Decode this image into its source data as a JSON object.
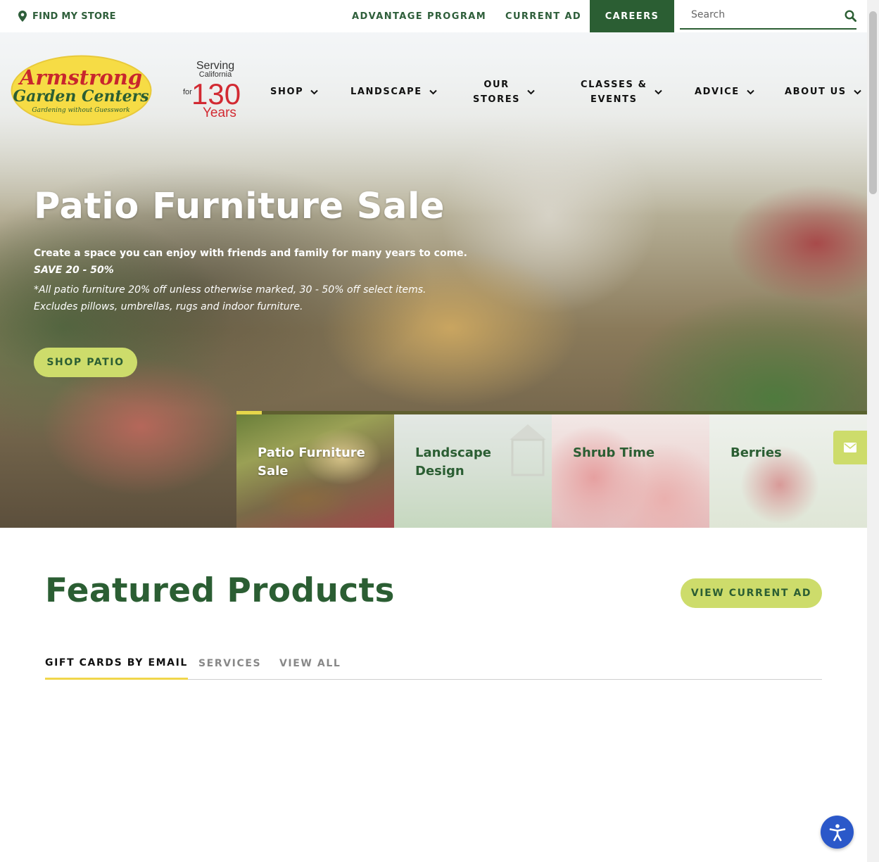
{
  "topbar": {
    "find_store": "FIND MY STORE",
    "links": [
      "ADVANTAGE PROGRAM",
      "CURRENT AD"
    ],
    "careers": "CAREERS",
    "search_placeholder": "Search"
  },
  "logo": {
    "line1": "Armstrong",
    "line2": "Garden Centers",
    "tagline": "Gardening without Guesswork"
  },
  "anniversary": {
    "serving": "Serving",
    "california": "California",
    "for": "for",
    "number": "130",
    "years": "Years"
  },
  "nav": {
    "shop": "SHOP",
    "landscape": "LANDSCAPE",
    "our_stores_1": "OUR",
    "our_stores_2": "STORES",
    "classes_1": "CLASSES &",
    "classes_2": "EVENTS",
    "advice": "ADVICE",
    "about": "ABOUT US"
  },
  "hero": {
    "title": "Patio Furniture Sale",
    "subtitle": "Create a space you can enjoy with friends and family for many years to come.",
    "save": "SAVE 20 - 50%",
    "note": "*All patio furniture 20% off unless otherwise marked, 30 - 50% off select items. Excludes pillows, umbrellas, rugs and indoor furniture.",
    "button": "SHOP PATIO"
  },
  "slides": [
    {
      "label": "Patio Furniture Sale"
    },
    {
      "label": "Landscape Design"
    },
    {
      "label": "Shrub Time"
    },
    {
      "label": "Berries"
    }
  ],
  "featured": {
    "title": "Featured Products",
    "view_ad": "VIEW CURRENT AD",
    "tabs": [
      "GIFT CARDS BY EMAIL",
      "SERVICES",
      "VIEW ALL"
    ]
  },
  "colors": {
    "brand_green": "#2b5e33",
    "accent_lime": "#cddc6b",
    "tab_underline": "#f0d64b",
    "a11y_blue": "#2b58c9"
  },
  "icons": {
    "find_store": "map-pin-icon",
    "search": "search-icon",
    "nav_chevron": "chevron-down-icon",
    "email": "envelope-icon",
    "accessibility": "accessibility-person-icon"
  }
}
